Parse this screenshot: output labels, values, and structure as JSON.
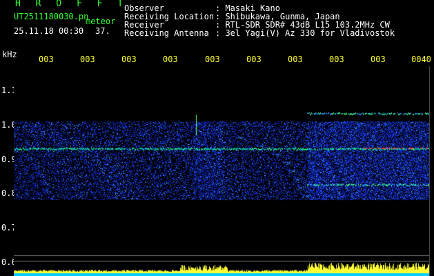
{
  "app": {
    "brand": "H R O F F T",
    "filename": "UT2511180030.pn",
    "mode_label": "meteor",
    "datetime": "25.11.18 00:30",
    "count": "37."
  },
  "header": {
    "observer_label": "Observer",
    "observer_value": ": Masaki Kano",
    "location_label": "Receiving Location",
    "location_value": ": Shibukawa, Gunma, Japan",
    "receiver_label": "Receiver",
    "receiver_value": ": RTL-SDR SDR# 43dB L15 103.2MHz CW",
    "antenna_label": "Receiving Antenna",
    "antenna_value": ": 3el Yagi(V) Az 330 for Vladivostok"
  },
  "axes": {
    "unit": "kHz",
    "y_ticks": [
      "1.1",
      "1.0",
      "0.9",
      "0.8",
      "0.7",
      "0.6"
    ],
    "x_ticks": [
      "003",
      "003",
      "003",
      "003",
      "003",
      "003",
      "003",
      "003",
      "003",
      "0040"
    ]
  },
  "colors": {
    "label_green": "#33ff33",
    "label_white": "#ffffff",
    "tick_yellow": "#ffff33",
    "noise_blue": "#1a3cff",
    "echo_green": "#33ff66",
    "echo_red": "#ff3333",
    "bar_cyan": "#00ccff"
  }
}
